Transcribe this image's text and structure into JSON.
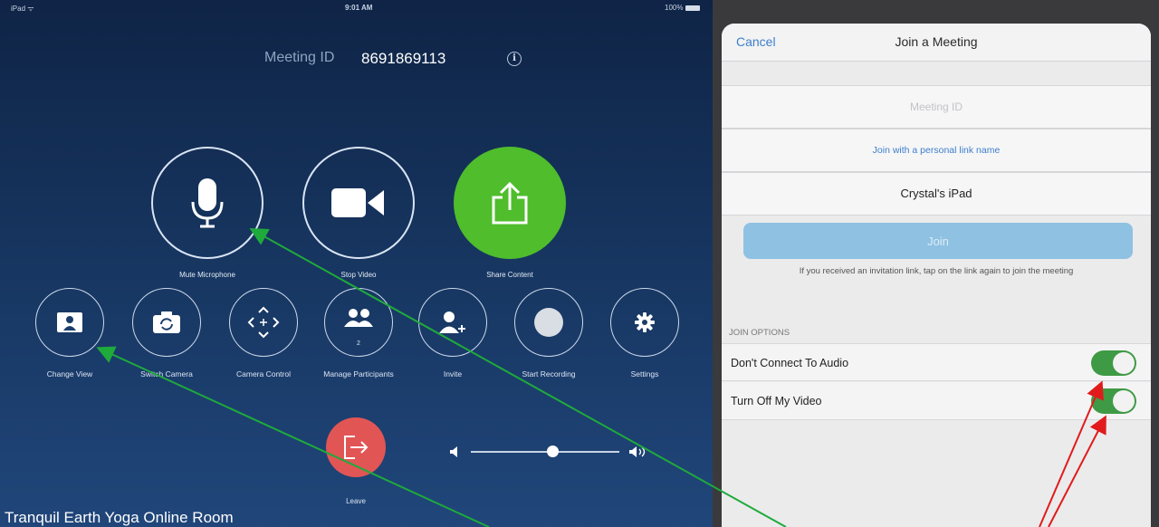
{
  "left": {
    "status_bar": {
      "carrier": "iPad ᯤ",
      "time": "9:01 AM",
      "battery": "100%"
    },
    "meeting_id_label": "Meeting ID",
    "meeting_id": "8691869113",
    "info_icon": "info-icon",
    "primary_buttons": [
      {
        "label": "Mute Microphone",
        "icon": "microphone-icon"
      },
      {
        "label": "Stop Video",
        "icon": "video-camera-icon"
      },
      {
        "label": "Share Content",
        "icon": "share-icon"
      }
    ],
    "secondary_buttons": [
      {
        "label": "Change View",
        "icon": "gallery-view-icon"
      },
      {
        "label": "Switch Camera",
        "icon": "switch-camera-icon"
      },
      {
        "label": "Camera Control",
        "icon": "camera-control-icon"
      },
      {
        "label": "Manage Participants",
        "icon": "participants-icon",
        "count": "2"
      },
      {
        "label": "Invite",
        "icon": "invite-icon"
      },
      {
        "label": "Start Recording",
        "icon": "record-icon"
      },
      {
        "label": "Settings",
        "icon": "gear-icon"
      }
    ],
    "leave_label": "Leave",
    "volume_level": 0.55,
    "room_name": "Tranquil Earth Yoga  Online Room"
  },
  "right": {
    "cancel": "Cancel",
    "title": "Join a Meeting",
    "meeting_id_placeholder": "Meeting ID",
    "personal_link": "Join with a personal link name",
    "device_name": "Crystal's iPad",
    "join_label": "Join",
    "hint": "If you received an invitation link, tap on the link again to join the meeting",
    "section_title": "JOIN OPTIONS",
    "options": [
      {
        "label": "Don't Connect To Audio",
        "on": true
      },
      {
        "label": "Turn Off My Video",
        "on": true
      }
    ]
  },
  "annotation_colors": {
    "green_arrow": "#1faa3c",
    "red_arrow": "#e11b1b"
  }
}
